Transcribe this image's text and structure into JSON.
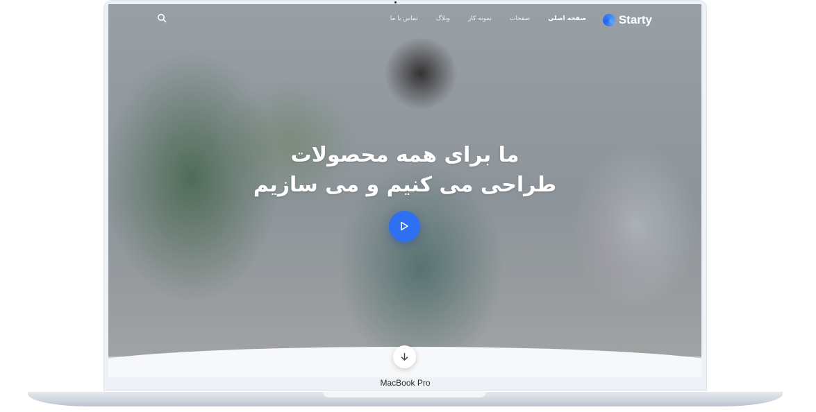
{
  "device": {
    "label": "MacBook Pro"
  },
  "nav": {
    "brand": "Starty",
    "items": [
      {
        "label": "صفحه اصلی",
        "active": true
      },
      {
        "label": "صفحات",
        "active": false
      },
      {
        "label": "نمونه کار",
        "active": false
      },
      {
        "label": "وبلاگ",
        "active": false
      },
      {
        "label": "تماس با ما",
        "active": false
      }
    ],
    "search_icon": "search-icon"
  },
  "hero": {
    "headline_line1": "ما برای همه محصولات",
    "headline_line2": "طراحی می کنیم و می سازیم",
    "play_icon": "play-icon",
    "scroll_icon": "arrow-down-icon"
  },
  "colors": {
    "accent": "#2f6ff2",
    "brand": "#3b82f6"
  }
}
